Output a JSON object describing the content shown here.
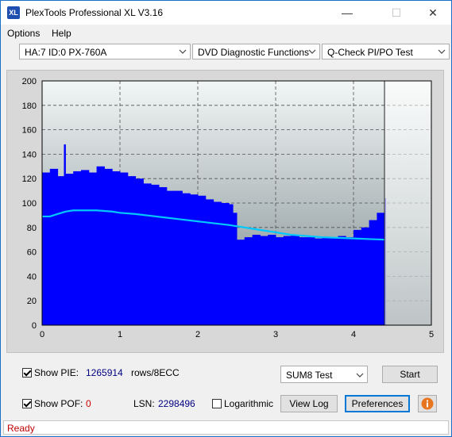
{
  "window": {
    "title": "PlexTools Professional XL V3.16",
    "icon_text": "XL",
    "min_icon": "minimize-icon",
    "max_icon": "maximize-icon",
    "close_icon": "close-icon"
  },
  "menu": [
    {
      "label": "Options",
      "underline": "O"
    },
    {
      "label": "Help",
      "underline": "H"
    }
  ],
  "selectors": {
    "drive": "HA:7 ID:0  PX-760A",
    "function": "DVD Diagnostic Functions",
    "test": "Q-Check PI/PO Test"
  },
  "chart_data": {
    "type": "area",
    "x_ticks": [
      "0",
      "1",
      "2",
      "3",
      "4",
      "5"
    ],
    "y_ticks": [
      "0",
      "20",
      "40",
      "60",
      "80",
      "100",
      "120",
      "140",
      "160",
      "180",
      "200"
    ],
    "xlim": [
      0,
      5
    ],
    "ylim": [
      0,
      200
    ],
    "grid": true,
    "end_marker_x": 4.4,
    "series": [
      {
        "kind": "bars",
        "color": "#0000ff",
        "x": [
          0.0,
          0.1,
          0.2,
          0.28,
          0.3,
          0.4,
          0.5,
          0.6,
          0.7,
          0.8,
          0.9,
          1.0,
          1.1,
          1.2,
          1.3,
          1.4,
          1.5,
          1.6,
          1.7,
          1.8,
          1.9,
          2.0,
          2.1,
          2.2,
          2.3,
          2.4,
          2.45,
          2.5,
          2.6,
          2.7,
          2.8,
          2.9,
          3.0,
          3.1,
          3.2,
          3.3,
          3.4,
          3.5,
          3.6,
          3.7,
          3.8,
          3.9,
          4.0,
          4.1,
          4.2,
          4.3,
          4.4
        ],
        "y": [
          125,
          128,
          122,
          148,
          124,
          126,
          127,
          125,
          130,
          128,
          126,
          125,
          122,
          120,
          116,
          115,
          113,
          110,
          110,
          108,
          107,
          106,
          103,
          101,
          100,
          99,
          92,
          70,
          72,
          74,
          73,
          74,
          72,
          73,
          74,
          72,
          72,
          71,
          72,
          72,
          73,
          72,
          78,
          80,
          86,
          92,
          104
        ]
      },
      {
        "kind": "line",
        "color": "#00c8ff",
        "x": [
          0.0,
          0.1,
          0.2,
          0.3,
          0.4,
          0.5,
          0.6,
          0.7,
          0.8,
          0.9,
          1.0,
          1.2,
          1.4,
          1.6,
          1.8,
          2.0,
          2.2,
          2.4,
          2.6,
          2.8,
          3.0,
          3.2,
          3.4,
          3.6,
          3.8,
          4.0,
          4.2,
          4.4
        ],
        "y": [
          89,
          89,
          91,
          93,
          94,
          94,
          94,
          94,
          93.5,
          93,
          92,
          91,
          89.5,
          88,
          86.5,
          85,
          83.5,
          82,
          80,
          78,
          76,
          74,
          73,
          72,
          71.5,
          71,
          70.5,
          70
        ]
      }
    ]
  },
  "controls": {
    "show_pie_label": "Show PIE:",
    "pie_value": "1265914",
    "pie_unit": "rows/8ECC",
    "show_pof_label": "Show POF:",
    "pof_value": "0",
    "lsn_label": "LSN:",
    "lsn_value": "2298496",
    "logarithmic_label": "Logarithmic",
    "sum_select": "SUM8 Test",
    "start_button": "Start",
    "view_log_button": "View Log",
    "preferences_button": "Preferences",
    "info_icon": "info-icon"
  },
  "status": {
    "text": "Ready"
  },
  "colors": {
    "pie_value": "#000080",
    "pof_value": "#cc0000",
    "status_text": "#c00000",
    "info_button": "#e8761e"
  }
}
